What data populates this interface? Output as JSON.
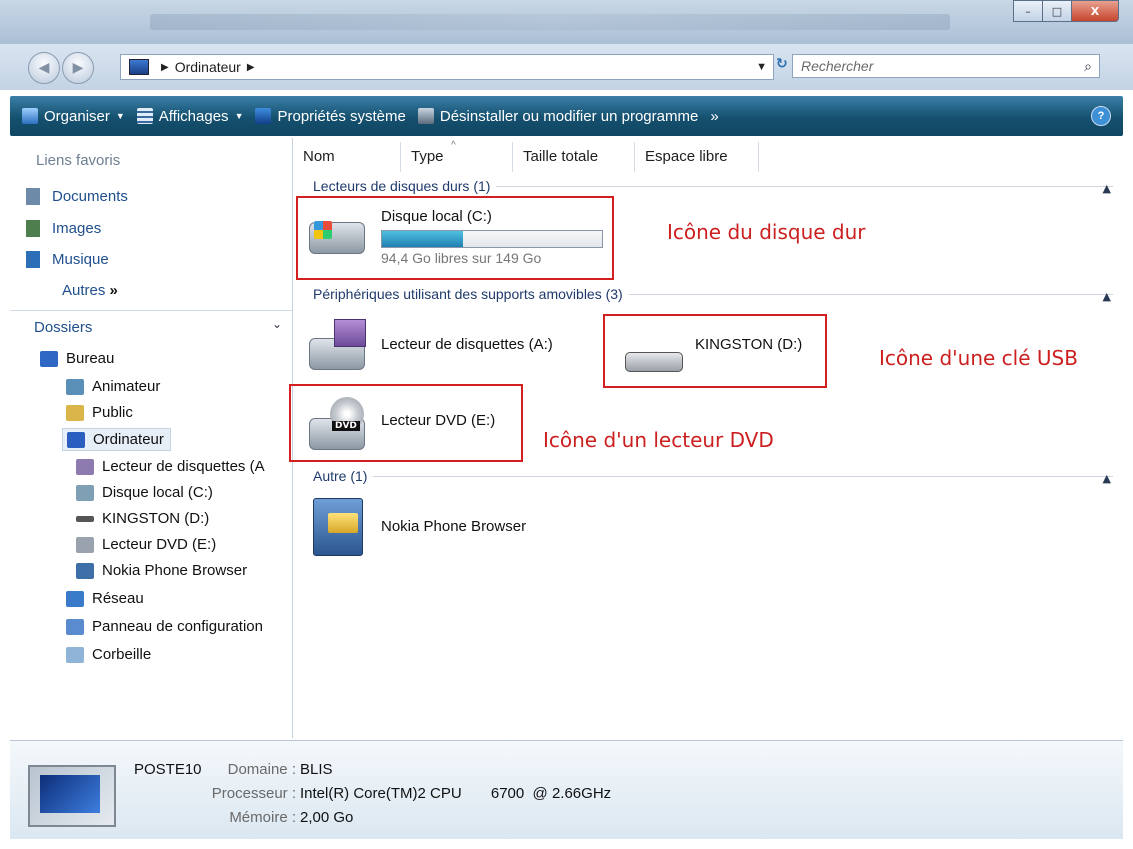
{
  "window": {
    "minimize_glyph": "–",
    "maximize_glyph": "□",
    "close_glyph": "X"
  },
  "nav": {
    "back_glyph": "◀",
    "forward_glyph": "▶",
    "breadcrumb": "Ordinateur",
    "sep_glyph": "▶",
    "dropdown_glyph": "▼",
    "refresh_glyph": "↻",
    "search_placeholder": "Rechercher",
    "search_glyph": "⌕"
  },
  "toolbar": {
    "organiser": "Organiser",
    "affichages": "Affichages",
    "proprietes": "Propriétés système",
    "desinstaller": "Désinstaller ou modifier un programme",
    "more": "»",
    "caret": "▼",
    "help": "?"
  },
  "sidebar": {
    "fav_title": "Liens favoris",
    "favorites": [
      {
        "label": "Documents",
        "color": "#6d8aa8"
      },
      {
        "label": "Images",
        "color": "#4e7e4e"
      },
      {
        "label": "Musique",
        "color": "#2d6fb7"
      }
    ],
    "autres": "Autres",
    "autres_glyph": "»",
    "dossiers": "Dossiers",
    "dossiers_chev": "⌄",
    "tree": [
      {
        "label": "Bureau",
        "color": "#2f67c4"
      },
      {
        "label": "Animateur",
        "color": "#5a8fb7"
      },
      {
        "label": "Public",
        "color": "#d9b54a"
      },
      {
        "label": "Ordinateur",
        "color": "#2a5fbf"
      },
      {
        "label": "Lecteur de disquettes (A",
        "color": "#8d7bb0"
      },
      {
        "label": "Disque local (C:)",
        "color": "#7fa0b4"
      },
      {
        "label": "KINGSTON (D:)",
        "color": "#555555"
      },
      {
        "label": "Lecteur DVD (E:)",
        "color": "#9aa3ad"
      },
      {
        "label": "Nokia Phone Browser",
        "color": "#3e6fa8"
      },
      {
        "label": "Réseau",
        "color": "#3a7bc9"
      },
      {
        "label": "Panneau de configuration",
        "color": "#5b8bcf"
      },
      {
        "label": "Corbeille",
        "color": "#8fb4d8"
      }
    ]
  },
  "columns": [
    "Nom",
    "Type",
    "Taille totale",
    "Espace libre"
  ],
  "sort_glyph": "^",
  "groups": {
    "hdd": "Lecteurs de disques durs (1)",
    "removable": "Périphériques utilisant des supports amovibles (3)",
    "other": "Autre (1)",
    "collapse_glyph": "▲"
  },
  "items": {
    "c_drive": {
      "name": "Disque local (C:)",
      "free": "94,4 Go libres sur 149 Go",
      "used_fraction": 0.37
    },
    "floppy": {
      "name": "Lecteur de disquettes (A:)"
    },
    "usb": {
      "name": "KINGSTON (D:)"
    },
    "dvd": {
      "name": "Lecteur DVD (E:)",
      "badge": "DVD"
    },
    "nokia": {
      "name": "Nokia Phone Browser"
    }
  },
  "annotations": {
    "hdd": "Icône du disque dur",
    "usb": "Icône d'une clé USB",
    "dvd": "Icône d'un lecteur DVD",
    "color": "#cc1f1f"
  },
  "details": {
    "computer": "POSTE10",
    "domain_label": "Domaine :",
    "domain": "BLIS",
    "cpu_label": "Processeur :",
    "cpu": "Intel(R) Core(TM)2 CPU       6700  @ 2.66GHz",
    "mem_label": "Mémoire :",
    "mem": "2,00 Go"
  }
}
